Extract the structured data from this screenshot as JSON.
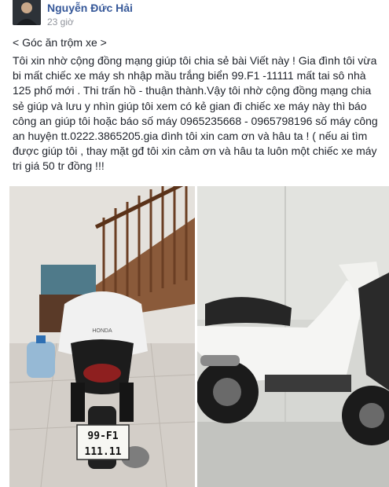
{
  "post": {
    "author": "Nguyễn Đức Hải",
    "timestamp": "23 giờ",
    "caption": "< Góc ăn trộm xe >",
    "text": "Tôi xin nhờ cộng đồng mạng giúp tôi chia sẻ bài Viết này ! Gia đình tôi vừa bi mất chiếc xe máy sh nhập mầu trắng biển 99.F1 -11111 mất tai sô nhà 125 phố mới . Thi trấn hồ - thuận thành.Vậy tôi nhờ cộng đồng mạng chia sẻ giúp và lưu y nhìn giúp tôi xem có kẻ gian đi chiếc xe máy này thì báo công an giúp tôi hoặc báo số máy 0965235668 - 0965798196 số máy công an huyện tt.0222.3865205.gia dình tôi xin cam ơn và hâu ta ! ( nếu ai tìm được giúp tôi , thay mặt gđ tôi xin cảm ơn và hâu ta luôn một chiếc xe máy tri giá 50 tr đồng !!!"
  },
  "photos": {
    "left": {
      "plate_line1": "99-F1",
      "plate_line2": "111.11",
      "brand": "HONDA"
    }
  }
}
